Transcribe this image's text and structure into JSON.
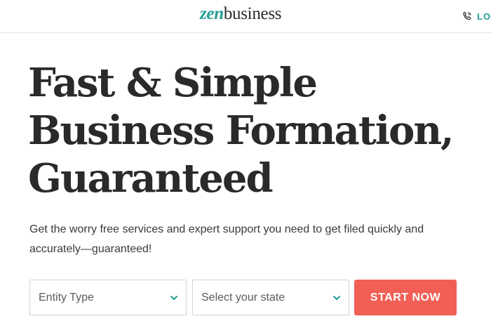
{
  "header": {
    "logo_zen": "zen",
    "logo_business": "business",
    "login_label": "LO"
  },
  "hero": {
    "headline": [
      "Fast & Simple",
      "Business Formation,",
      "Guaranteed"
    ],
    "subtext": "Get the worry free services and expert support you need to get filed quickly and accurately—guaranteed!"
  },
  "form": {
    "entity_type_placeholder": "Entity Type",
    "state_placeholder": "Select your state",
    "start_button_label": "START NOW"
  },
  "colors": {
    "brand_teal": "#1f9e93",
    "cta_red": "#f25f55"
  },
  "icons": {
    "phone": "phone-icon",
    "chevron": "chevron-down-icon"
  }
}
